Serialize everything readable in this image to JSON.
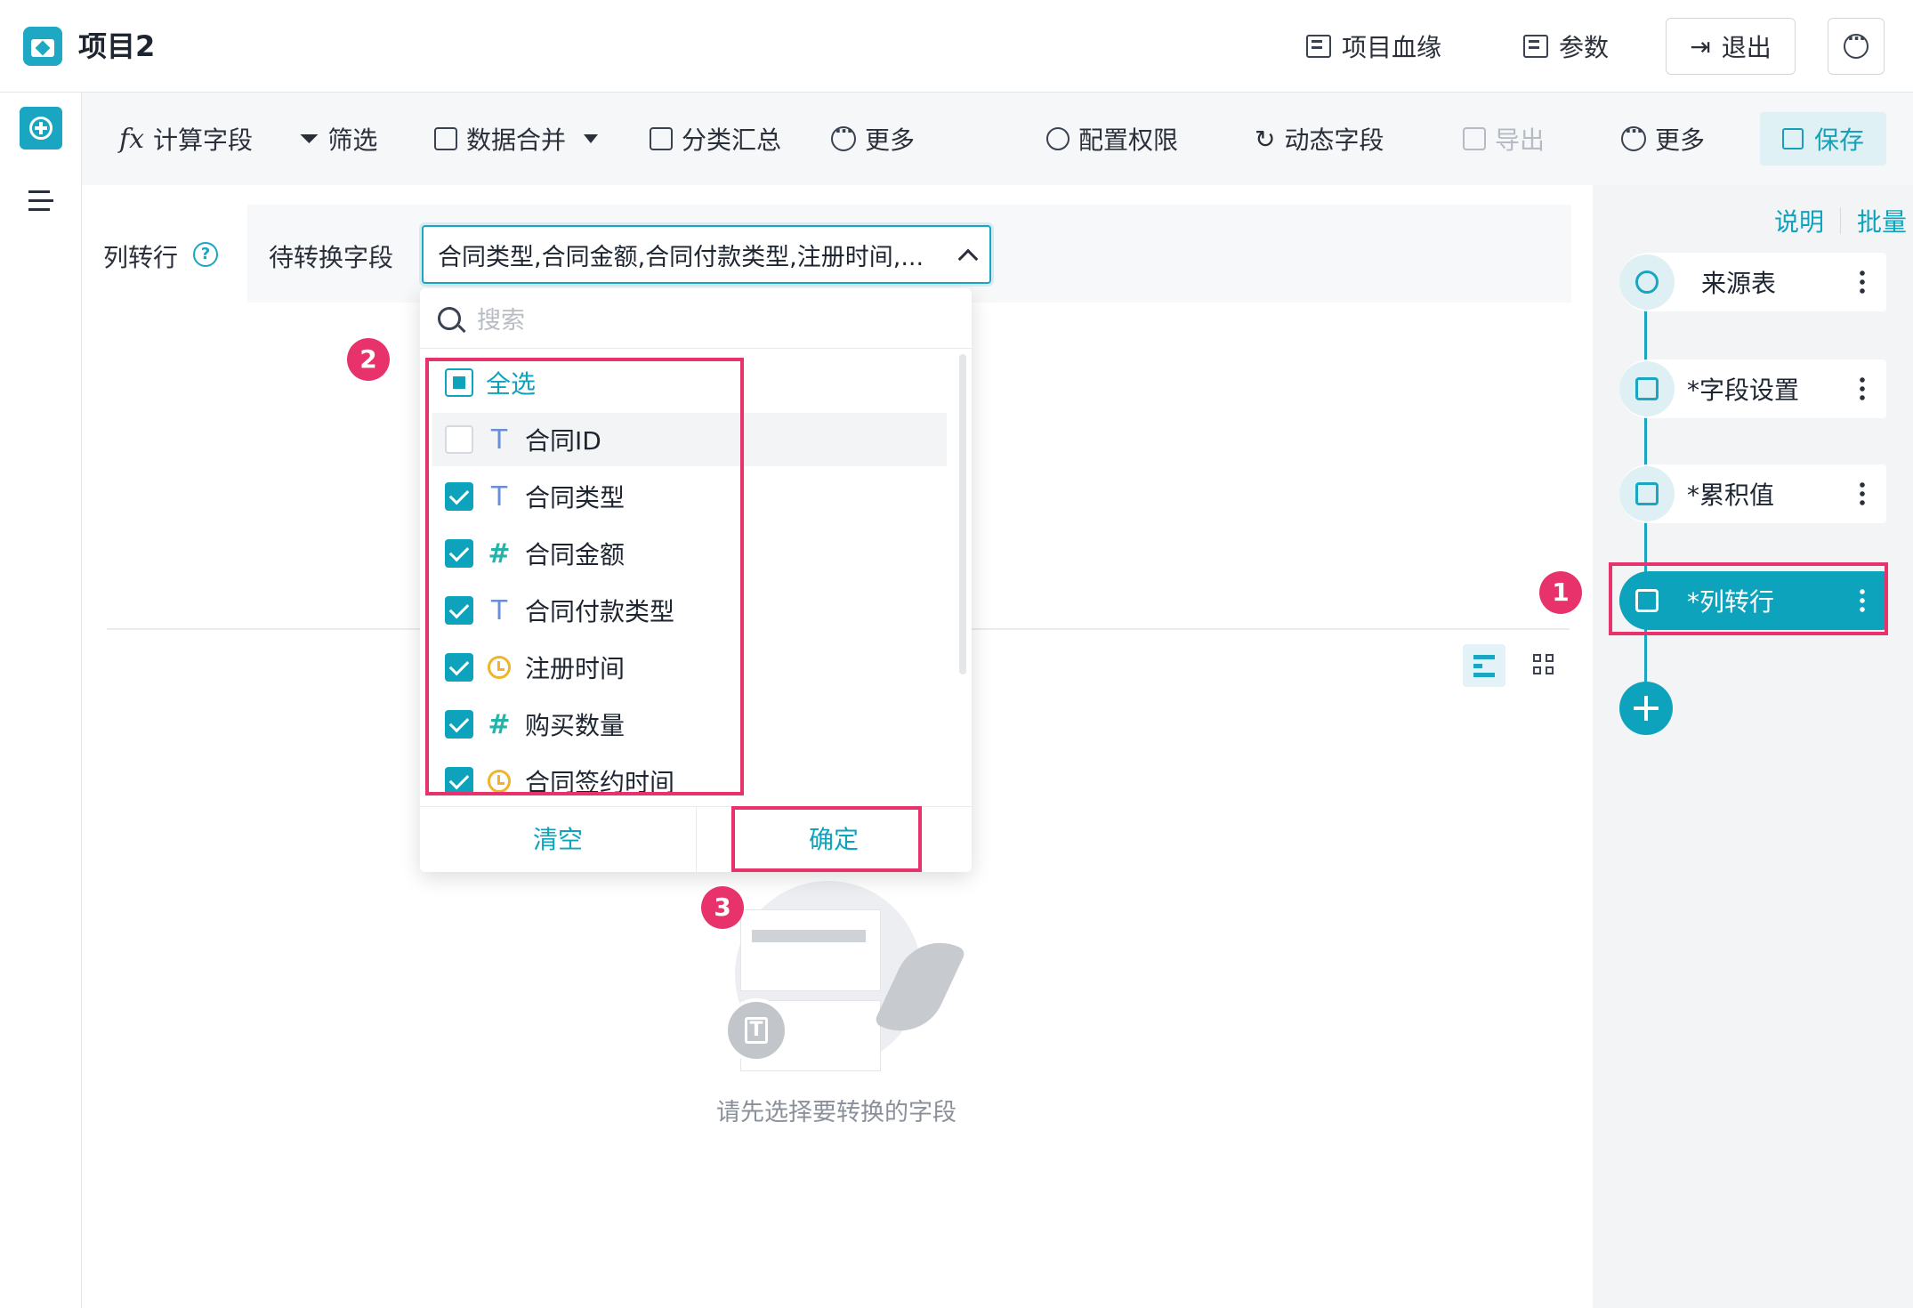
{
  "header": {
    "project_title": "项目2",
    "lineage_label": "项目血缘",
    "params_label": "参数",
    "exit_label": "退出"
  },
  "toolbar": {
    "calc_field": "计算字段",
    "filter": "筛选",
    "data_merge": "数据合并",
    "group_summary": "分类汇总",
    "more_left": "更多",
    "permissions": "配置权限",
    "dynamic_field": "动态字段",
    "export": "导出",
    "more_right": "更多",
    "save": "保存"
  },
  "config": {
    "section_label": "列转行",
    "help_icon_text": "?",
    "field_label": "待转换字段",
    "selected_value": "合同类型,合同金额,合同付款类型,注册时间,..."
  },
  "dropdown": {
    "search_placeholder": "搜索",
    "select_all": "全选",
    "items": [
      {
        "label": "合同ID",
        "type": "text",
        "type_glyph": "T",
        "checked": false
      },
      {
        "label": "合同类型",
        "type": "text",
        "type_glyph": "T",
        "checked": true
      },
      {
        "label": "合同金额",
        "type": "number",
        "type_glyph": "#",
        "checked": true
      },
      {
        "label": "合同付款类型",
        "type": "text",
        "type_glyph": "T",
        "checked": true
      },
      {
        "label": "注册时间",
        "type": "datetime",
        "type_glyph": "",
        "checked": true
      },
      {
        "label": "购买数量",
        "type": "number",
        "type_glyph": "#",
        "checked": true
      },
      {
        "label": "合同签约时间",
        "type": "datetime",
        "type_glyph": "",
        "checked": true
      }
    ],
    "clear_label": "清空",
    "confirm_label": "确定"
  },
  "empty_state": {
    "icon_glyph": "T",
    "message": "请先选择要转换的字段"
  },
  "right_panel": {
    "explain_link": "说明",
    "batch_link": "批量",
    "steps": [
      {
        "label": "来源表",
        "icon": "crosshair-icon",
        "active": false
      },
      {
        "label": "*字段设置",
        "icon": "field-settings-icon",
        "active": false
      },
      {
        "label": "*累积值",
        "icon": "cumulative-icon",
        "active": false
      },
      {
        "label": "*列转行",
        "icon": "unpivot-icon",
        "active": true
      }
    ]
  },
  "annotations": {
    "badge_1": "1",
    "badge_2": "2",
    "badge_3": "3"
  },
  "colors": {
    "accent": "#0ea3bd",
    "highlight": "#e8326b",
    "disabled": "#b6bbc3",
    "datetime_icon": "#f0b429",
    "number_icon": "#24b3a8",
    "text_icon": "#6b8fd6"
  }
}
